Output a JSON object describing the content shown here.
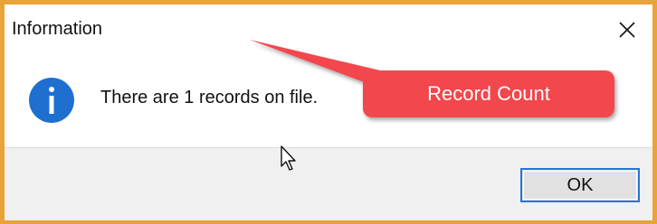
{
  "dialog": {
    "title": "Information",
    "message": "There are 1 records on file.",
    "ok_label": "OK",
    "icon": "info-icon",
    "close_icon": "close-icon"
  },
  "annotation": {
    "label": "Record Count",
    "color": "#f2474e"
  },
  "colors": {
    "frame": "#e8a33a",
    "accent": "#2677d9",
    "info_icon": "#1f6fd1"
  }
}
